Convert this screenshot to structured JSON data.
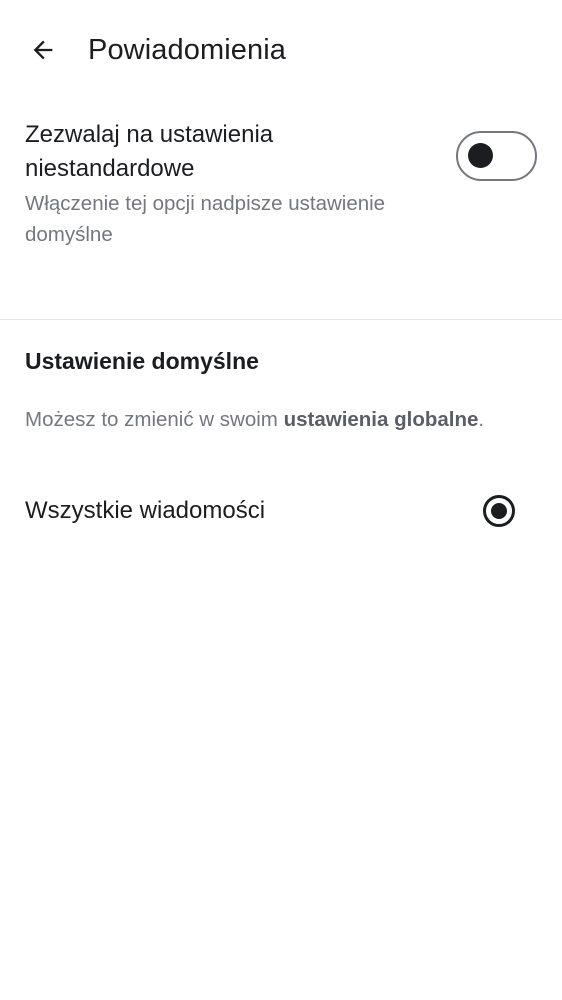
{
  "header": {
    "back_icon": "arrow-left-icon",
    "title": "Powiadomienia"
  },
  "custom_settings": {
    "title": "Zezwalaj na ustawienia niestandardowe",
    "description": "Włączenie tej opcji nadpisze ustawienie domyślne",
    "toggle_on": false
  },
  "default_section": {
    "heading": "Ustawienie domyślne",
    "info_prefix": "Możesz to zmienić w swoim ",
    "info_link": "ustawienia globalne",
    "info_suffix": "."
  },
  "options": [
    {
      "label": "Wszystkie wiadomości",
      "selected": true
    }
  ],
  "colors": {
    "text_primary": "#1b1d21",
    "text_secondary": "#737780",
    "divider": "#e4e5e9",
    "background": "#ffffff"
  }
}
